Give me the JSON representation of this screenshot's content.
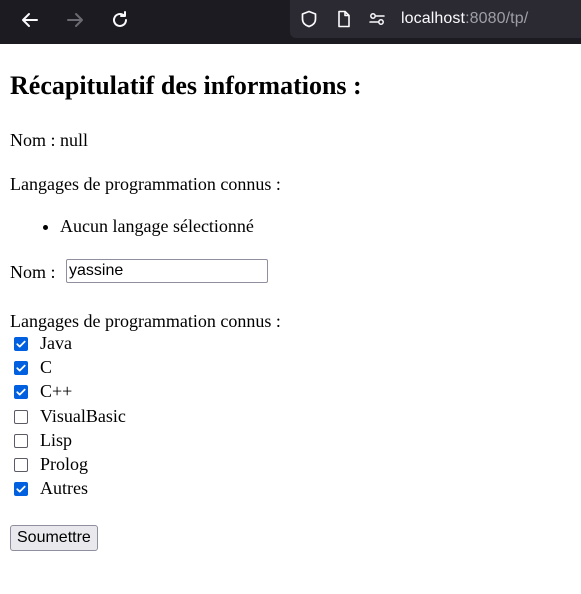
{
  "browser": {
    "url_host": "localhost",
    "url_rest": ":8080/tp/"
  },
  "recap": {
    "title": "Récapitulatif des informations :",
    "name_line": "Nom : null",
    "languages_heading": "Langages de programmation connus :",
    "languages_list": [
      "Aucun langage sélectionné"
    ]
  },
  "form": {
    "name_label": "Nom :",
    "name_value": "yassine",
    "languages_label": "Langages de programmation connus :",
    "options": [
      {
        "label": "Java",
        "checked": true
      },
      {
        "label": "C",
        "checked": true
      },
      {
        "label": "C++",
        "checked": true
      },
      {
        "label": "VisualBasic",
        "checked": false
      },
      {
        "label": "Lisp",
        "checked": false
      },
      {
        "label": "Prolog",
        "checked": false
      },
      {
        "label": "Autres",
        "checked": true
      }
    ],
    "submit_label": "Soumettre"
  },
  "colors": {
    "chrome_bg": "#1c1b22",
    "urlbar_bg": "#2b2a33",
    "checkbox_checked": "#0060df"
  }
}
